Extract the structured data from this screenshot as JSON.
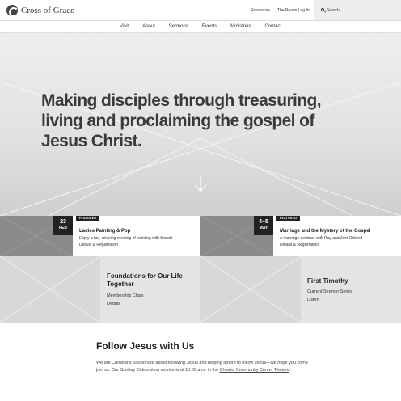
{
  "header": {
    "logo_text": "Cross of Grace",
    "utility_links": [
      "Resources",
      "The Realm Log In"
    ],
    "search_label": "Search"
  },
  "nav": {
    "items": [
      "Visit",
      "About",
      "Sermons",
      "Events",
      "Ministries",
      "Contact"
    ]
  },
  "hero": {
    "title": "Making disciples through treasuring, living and proclaiming the gospel of Jesus Christ."
  },
  "events": [
    {
      "day": "23",
      "month": "FEB",
      "tag": "FEATURED",
      "title": "Ladies Painting & Pop",
      "description": "Enjoy a fun, relaxing evening of painting with friends",
      "link": "Details & Registration"
    },
    {
      "day": "4–5",
      "month": "MAY",
      "tag": "FEATURED",
      "title": "Marriage and the Mystery of the Gospel",
      "description": "A marriage seminar with Ray and Jani Ortlund",
      "link": "Details & Registration"
    }
  ],
  "cards": [
    {
      "title": "Foundations for Our Life Together",
      "subtitle": "Membership Class",
      "link": "Details"
    },
    {
      "title": "First Timothy",
      "subtitle": "Current Sermon Series",
      "link": "Listen"
    }
  ],
  "intro": {
    "heading": "Follow Jesus with Us",
    "body_before_link": "We are Christians passionate about following Jesus and helping others to follow Jesus—we hope you come join us. Our Sunday Celebration service is at 10:00 a.m. in the ",
    "link_text": "Chaska Community Center Theatre",
    "body_after_link": "."
  }
}
